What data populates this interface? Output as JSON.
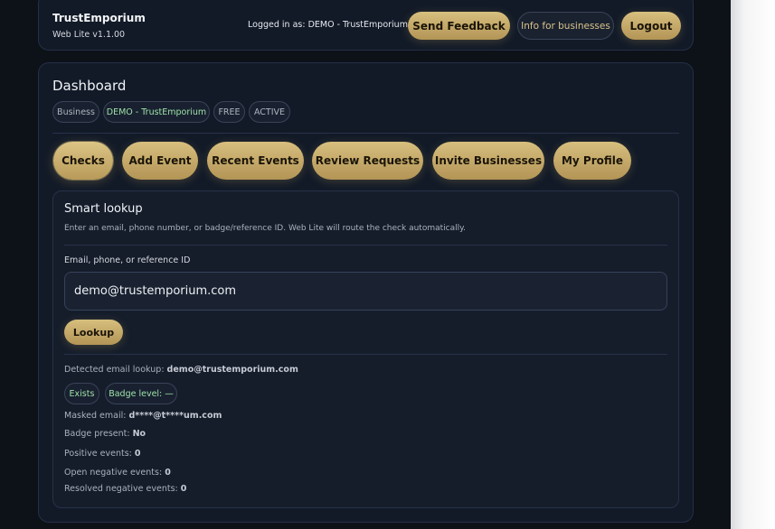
{
  "header": {
    "brand_name": "TrustEmporium",
    "version": "Web Lite v1.1.00",
    "logged_in_text": "Logged in as: DEMO - TrustEmporium",
    "buttons": {
      "feedback": "Send Feedback",
      "info": "Info for businesses",
      "logout": "Logout"
    }
  },
  "dashboard": {
    "title": "Dashboard",
    "chips": {
      "type": "Business",
      "name": "DEMO - TrustEmporium",
      "plan": "FREE",
      "status": "ACTIVE"
    },
    "tabs": [
      {
        "label": "Checks",
        "active": true
      },
      {
        "label": "Add Event",
        "active": false
      },
      {
        "label": "Recent Events",
        "active": false
      },
      {
        "label": "Review Requests",
        "active": false
      },
      {
        "label": "Invite Businesses",
        "active": false
      },
      {
        "label": "My Profile",
        "active": false
      }
    ]
  },
  "lookup": {
    "title": "Smart lookup",
    "description": "Enter an email, phone number, or badge/reference ID. Web Lite will route the check automatically.",
    "field_label": "Email, phone, or reference ID",
    "input_value": "demo@trustemporium.com",
    "button_label": "Lookup"
  },
  "result": {
    "detected_label": "Detected email lookup:",
    "detected_value": "demo@trustemporium.com",
    "badges": {
      "exists": "Exists",
      "level": "Badge level: —"
    },
    "masked_label": "Masked email:",
    "masked_value": "d****@t****um.com",
    "badge_present_label": "Badge present:",
    "badge_present_value": "No",
    "positive_label": "Positive events:",
    "positive_value": "0",
    "open_neg_label": "Open negative events:",
    "open_neg_value": "0",
    "resolved_neg_label": "Resolved negative events:",
    "resolved_neg_value": "0"
  },
  "colors": {
    "accent_gold": "#c9ad6a",
    "page_bg": "#0d1118",
    "card_bg": "#121a28",
    "status_green": "#9ee0a8"
  }
}
